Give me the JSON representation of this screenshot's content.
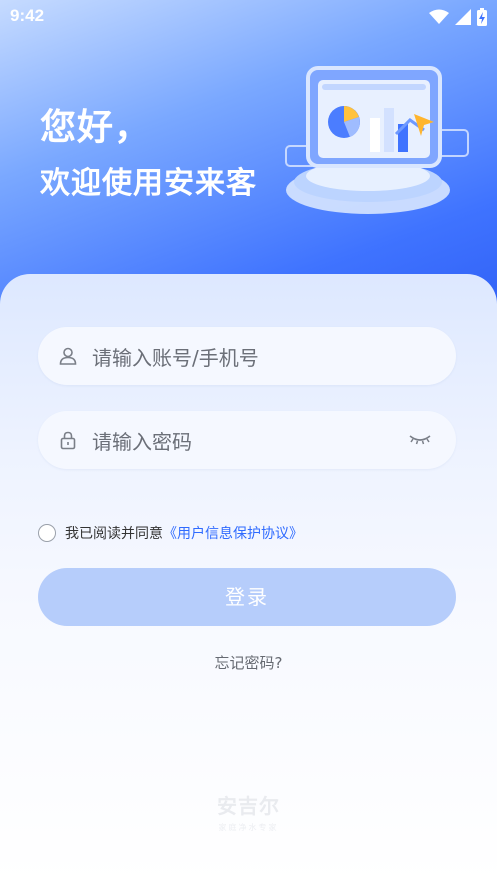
{
  "status_bar": {
    "time": "9:42",
    "icons": [
      "wifi-icon",
      "signal-icon",
      "battery-icon"
    ]
  },
  "hero": {
    "greeting": "您好，",
    "welcome": "欢迎使用安来客"
  },
  "form": {
    "account_placeholder": "请输入账号/手机号",
    "password_placeholder": "请输入密码",
    "agree_text": "我已阅读并同意",
    "agree_link": "《用户信息保护协议》",
    "login_label": "登录",
    "forgot_label": "忘记密码?"
  },
  "watermark": {
    "title": "安吉尔",
    "subtitle": "家庭净水专家"
  },
  "colors": {
    "primary": "#2f6bff",
    "button_disabled": "#b6cdfb",
    "hero_blue": "#3f73ff"
  }
}
